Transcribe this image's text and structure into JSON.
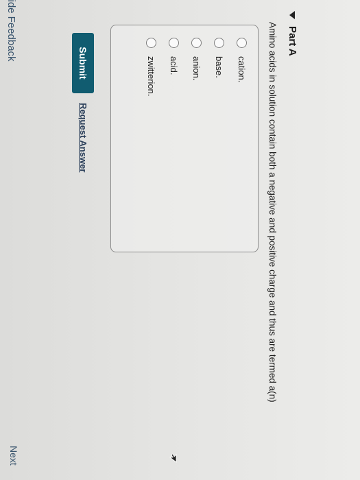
{
  "part": {
    "title": "Part A"
  },
  "question": {
    "text": "Amino acids in solution contain both a negative and positive charge and thus are termed a(n)"
  },
  "options": [
    {
      "label": "cation."
    },
    {
      "label": "base."
    },
    {
      "label": "anion."
    },
    {
      "label": "acid."
    },
    {
      "label": "zwitterion."
    }
  ],
  "actions": {
    "submit_label": "Submit",
    "request_answer_label": "Request Answer",
    "feedback_label": "vide Feedback",
    "next_label": "Next"
  },
  "colors": {
    "submit_bg": "#115c70",
    "link": "#3a556e",
    "background": "#e6e6e4"
  },
  "icons": [
    "collapse-caret-icon",
    "radio-icon",
    "mouse-pointer-icon"
  ]
}
